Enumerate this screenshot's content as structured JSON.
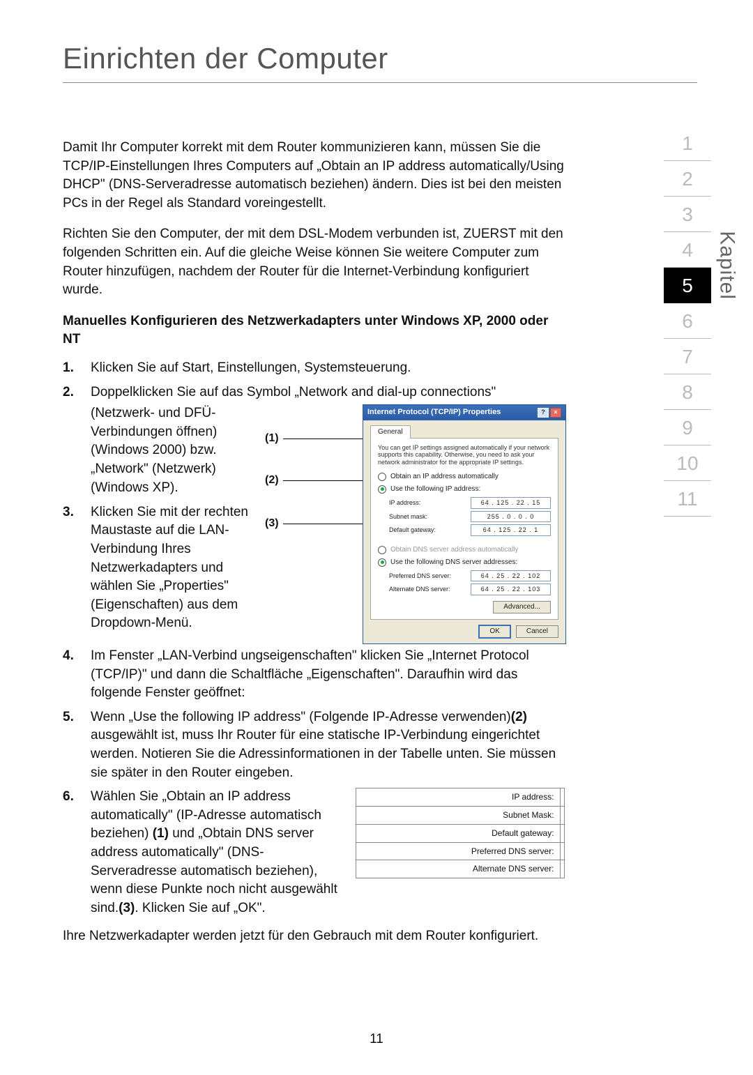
{
  "title": "Einrichten der Computer",
  "kapitel_label": "Kapitel",
  "nav": [
    "1",
    "2",
    "3",
    "4",
    "5",
    "6",
    "7",
    "8",
    "9",
    "10",
    "11"
  ],
  "active_nav": 4,
  "intro": {
    "p1": "Damit Ihr Computer korrekt mit dem Router kommunizieren kann, müssen Sie die TCP/IP-Einstellungen Ihres Computers auf „Obtain an IP address automatically/Using DHCP\" (DNS-Serveradresse automatisch beziehen) ändern. Dies ist bei den meisten PCs in der Regel als Standard voreingestellt.",
    "p2": " Richten Sie den Computer, der mit dem DSL-Modem verbunden ist, ZUERST mit den folgenden Schritten ein. Auf die gleiche Weise können Sie weitere Computer zum Router hinzufügen, nachdem der Router für die Internet-Verbindung konfiguriert wurde."
  },
  "section_heading": "Manuelles Konfigurieren des Netzwerkadapters unter Windows XP, 2000 oder NT",
  "steps": {
    "s1": "Klicken Sie auf Start, Einstellungen, Systemsteuerung.",
    "s2_lead": "Doppelklicken Sie auf das Symbol „Network and dial-up connections\"",
    "s2_rest": "(Netzwerk- und DFÜ-Verbindungen öffnen) (Windows 2000) bzw. „Network\" (Netzwerk) (Windows XP).",
    "s3": "Klicken Sie mit der rechten Maustaste auf die LAN-Verbindung Ihres Netzwerkadapters und wählen Sie „Properties\" (Eigenschaften) aus dem Dropdown-Menü.",
    "s4": "Im Fenster „LAN-Verbind ungseigenschaften\"  klicken Sie „Internet Protocol (TCP/IP)\" und dann die Schaltfläche „Eigenschaften\". Daraufhin wird das folgende Fenster geöffnet:",
    "s5_a": "Wenn „Use the following IP address\" (Folgende IP-Adresse verwenden)",
    "s5_b": " ausgewählt ist, muss Ihr Router für eine statische IP-Verbindung eingerichtet werden. Notieren Sie die Adressinformationen in der Tabelle unten. Sie müssen sie später in den Router eingeben.",
    "s5_tag": "(2)",
    "s6_a": "Wählen Sie „Obtain an IP address automatically\" (IP-Adresse automatisch beziehen) ",
    "s6_tag1": "(1)",
    "s6_b": " und „Obtain DNS server address automatically\" (DNS-Serveradresse automatisch beziehen), wenn diese Punkte noch nicht ausgewählt sind.",
    "s6_tag2": "(3)",
    "s6_c": ". Klicken Sie auf „OK\"."
  },
  "closing": "Ihre Netzwerkadapter werden jetzt für den Gebrauch mit dem Router konfiguriert.",
  "page_number": "11",
  "callouts": {
    "c1": "(1)",
    "c2": "(2)",
    "c3": "(3)"
  },
  "dialog": {
    "title": "Internet Protocol (TCP/IP) Properties",
    "help": "?",
    "close": "×",
    "tab": "General",
    "desc": "You can get IP settings assigned automatically if your network supports this capability. Otherwise, you need to ask your network administrator for the appropriate IP settings.",
    "r1": "Obtain an IP address automatically",
    "r2": "Use the following IP address:",
    "ip_label": "IP address:",
    "ip_value": "64 . 125 . 22 .  15",
    "mask_label": "Subnet mask:",
    "mask_value": "255 .  0  .  0  .   0",
    "gw_label": "Default gateway:",
    "gw_value": "64 . 125 . 22 .   1",
    "r3": "Obtain DNS server address automatically",
    "r4": "Use the following DNS server addresses:",
    "pdns_label": "Preferred DNS server:",
    "pdns_value": "64 . 25 . 22 . 102",
    "adns_label": "Alternate DNS server:",
    "adns_value": "64 . 25 . 22 . 103",
    "advanced": "Advanced...",
    "ok": "OK",
    "cancel": "Cancel"
  },
  "smalltable": {
    "r1": "IP address:",
    "r2": "Subnet Mask:",
    "r3": "Default gateway:",
    "r4": "Preferred DNS server:",
    "r5": "Alternate DNS server:"
  }
}
